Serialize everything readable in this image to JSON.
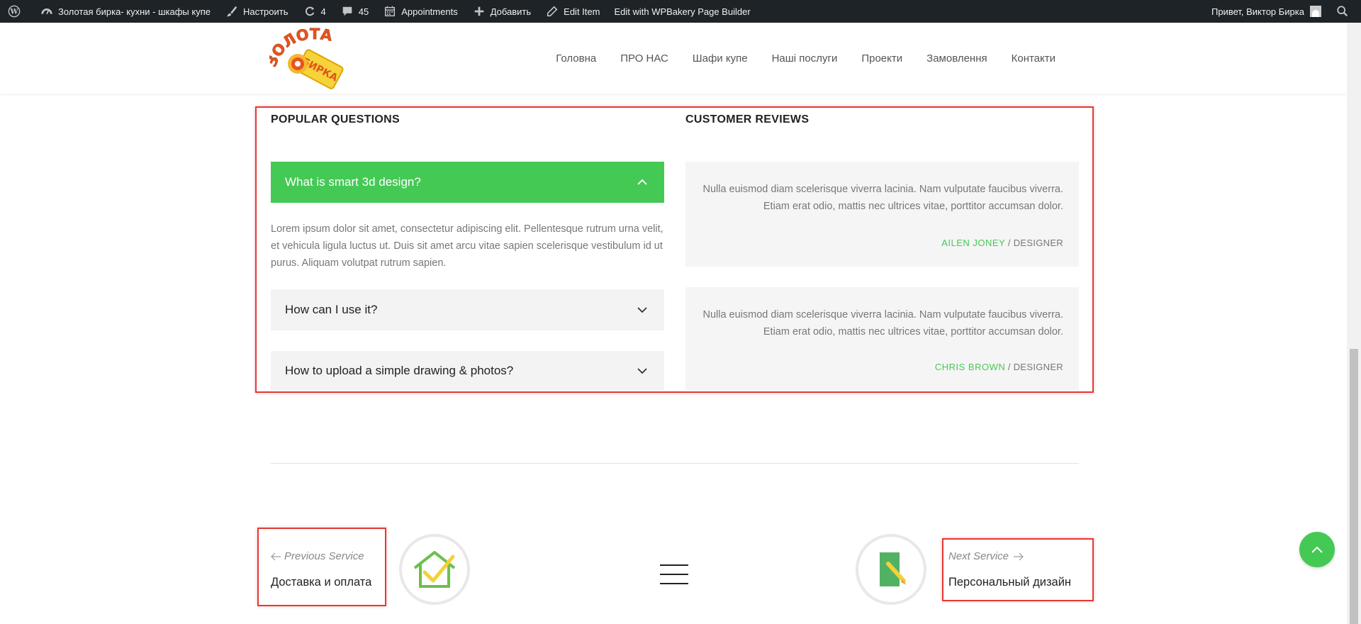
{
  "adminbar": {
    "site_name": "Золотая бирка- кухни - шкафы купе",
    "customize": "Настроить",
    "updates_count": "4",
    "comments_count": "45",
    "appointments": "Appointments",
    "add_new": "Добавить",
    "edit_item": "Edit Item",
    "edit_builder": "Edit with WPBakery Page Builder",
    "greeting": "Привет, Виктор Бирка"
  },
  "logo": {
    "line1": "ЗОЛОТАЯ",
    "line2": "БИРКА"
  },
  "nav": {
    "items": [
      "Головна",
      "ПРО НАС",
      "Шафи купе",
      "Наші послуги",
      "Проекти",
      "Замовлення",
      "Контакти"
    ]
  },
  "faq": {
    "title": "POPULAR QUESTIONS",
    "items": [
      {
        "question": "What is smart 3d design?",
        "open": true
      },
      {
        "question": "How can I use it?",
        "open": false
      },
      {
        "question": "How to upload a simple drawing & photos?",
        "open": false
      }
    ],
    "answer": "Lorem ipsum dolor sit amet, consectetur adipiscing elit. Pellentesque rutrum urna velit, et vehicula ligula luctus ut. Duis sit amet arcu vitae sapien scelerisque vestibulum id ut purus. Aliquam volutpat rutrum sapien."
  },
  "reviews": {
    "title": "CUSTOMER REVIEWS",
    "items": [
      {
        "text": "Nulla euismod diam scelerisque viverra lacinia. Nam vulputate faucibus viverra. Etiam erat odio, mattis nec ultrices vitae, porttitor accumsan dolor.",
        "name": "AILEN JONEY",
        "role": "/ DESIGNER"
      },
      {
        "text": "Nulla euismod diam scelerisque viverra lacinia. Nam vulputate faucibus viverra. Etiam erat odio, mattis nec ultrices vitae, porttitor accumsan dolor.",
        "name": "CHRIS BROWN",
        "role": "/ DESIGNER"
      }
    ]
  },
  "pagination": {
    "prev_label": "Previous Service",
    "prev_title": "Доставка и оплата",
    "next_label": "Next Service",
    "next_title": "Персональный дизайн"
  },
  "colors": {
    "accent": "#45c955",
    "adminbar": "#1d2327",
    "highlight": "#e53935"
  },
  "icons": [
    "wordpress-icon",
    "dashboard-icon",
    "brush-icon",
    "updates-icon",
    "comments-icon",
    "calendar-icon",
    "plus-icon",
    "pencil-icon",
    "search-icon",
    "chevron-up-icon",
    "chevron-down-icon",
    "arrow-left-icon",
    "arrow-right-icon",
    "house-check-icon",
    "ruler-pencil-icon",
    "hamburger-menu-icon",
    "chevron-up-icon"
  ]
}
